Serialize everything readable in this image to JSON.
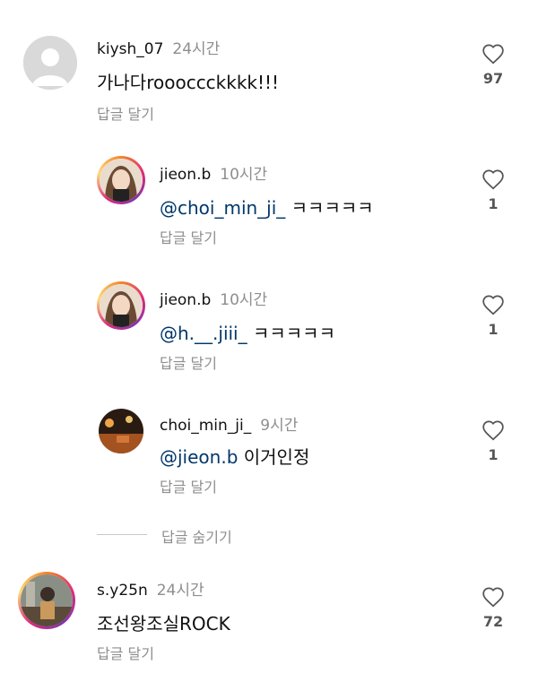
{
  "comments": [
    {
      "username": "kiysh_07",
      "time": "24시간",
      "text": "가나다roooccckkkk!!!",
      "reply_label": "답글 달기",
      "likes": "97",
      "avatar": "default-avatar"
    },
    {
      "username": "jieon.b",
      "time": "10시간",
      "mention": "@choi_min_ji_",
      "text": " ㅋㅋㅋㅋㅋ",
      "reply_label": "답글 달기",
      "likes": "1",
      "avatar": "profile-photo"
    },
    {
      "username": "jieon.b",
      "time": "10시간",
      "mention": "@h.__.jiii_",
      "text": " ㅋㅋㅋㅋㅋ",
      "reply_label": "답글 달기",
      "likes": "1",
      "avatar": "profile-photo"
    },
    {
      "username": "choi_min_ji_",
      "time": "9시간",
      "mention": "@jieon.b",
      "text": " 이거인정",
      "reply_label": "답글 달기",
      "likes": "1",
      "avatar": "profile-photo"
    },
    {
      "username": "s.y25n",
      "time": "24시간",
      "text": "조선왕조실ROCK",
      "reply_label": "답글 달기",
      "likes": "72",
      "avatar": "profile-photo"
    }
  ],
  "hide_replies_label": "답글 숨기기",
  "icons": {
    "like": "heart-outline-icon"
  },
  "colors": {
    "mention": "#00376b",
    "secondary_text": "#8e8e8e",
    "story_ring": "#dd2a7b"
  }
}
